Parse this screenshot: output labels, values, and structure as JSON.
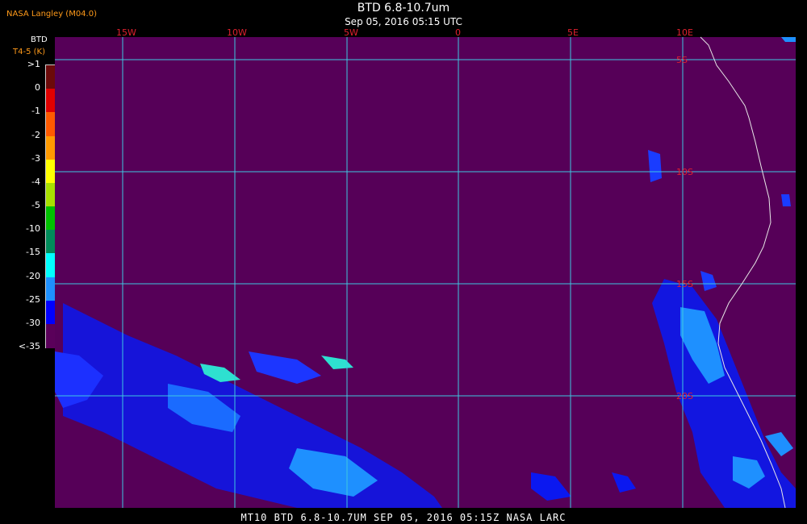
{
  "header": {
    "agency": "NASA Langley (M04.0)",
    "title": "BTD 6.8-10.7um",
    "subtitle": "Sep 05, 2016 05:15 UTC"
  },
  "legend": {
    "title": "BTD",
    "units": "T4-5 (K)",
    "ticks": [
      ">1",
      "0",
      "-1",
      "-2",
      "-3",
      "-4",
      "-5",
      "-10",
      "-15",
      "-20",
      "-25",
      "-30",
      "<-35"
    ],
    "colors": [
      "#6b0a0a",
      "#e00000",
      "#ff5a00",
      "#ff9a00",
      "#ffff00",
      "#a8e000",
      "#00c000",
      "#008a5a",
      "#00ffff",
      "#1e90ff",
      "#0000ff",
      "#5a005a"
    ]
  },
  "map": {
    "background_color": "#560058",
    "grid_color": "#3ec8e0",
    "coast_color": "#e8e8e8",
    "longitude_labels": [
      "15W",
      "10W",
      "5W",
      "0",
      "5E",
      "10E"
    ],
    "latitude_labels": [
      "5S",
      "10S",
      "15S",
      "20S"
    ]
  },
  "footer": {
    "caption": "MT10  BTD 6.8-10.7UM   SEP 05, 2016 05:15Z   NASA LARC"
  }
}
